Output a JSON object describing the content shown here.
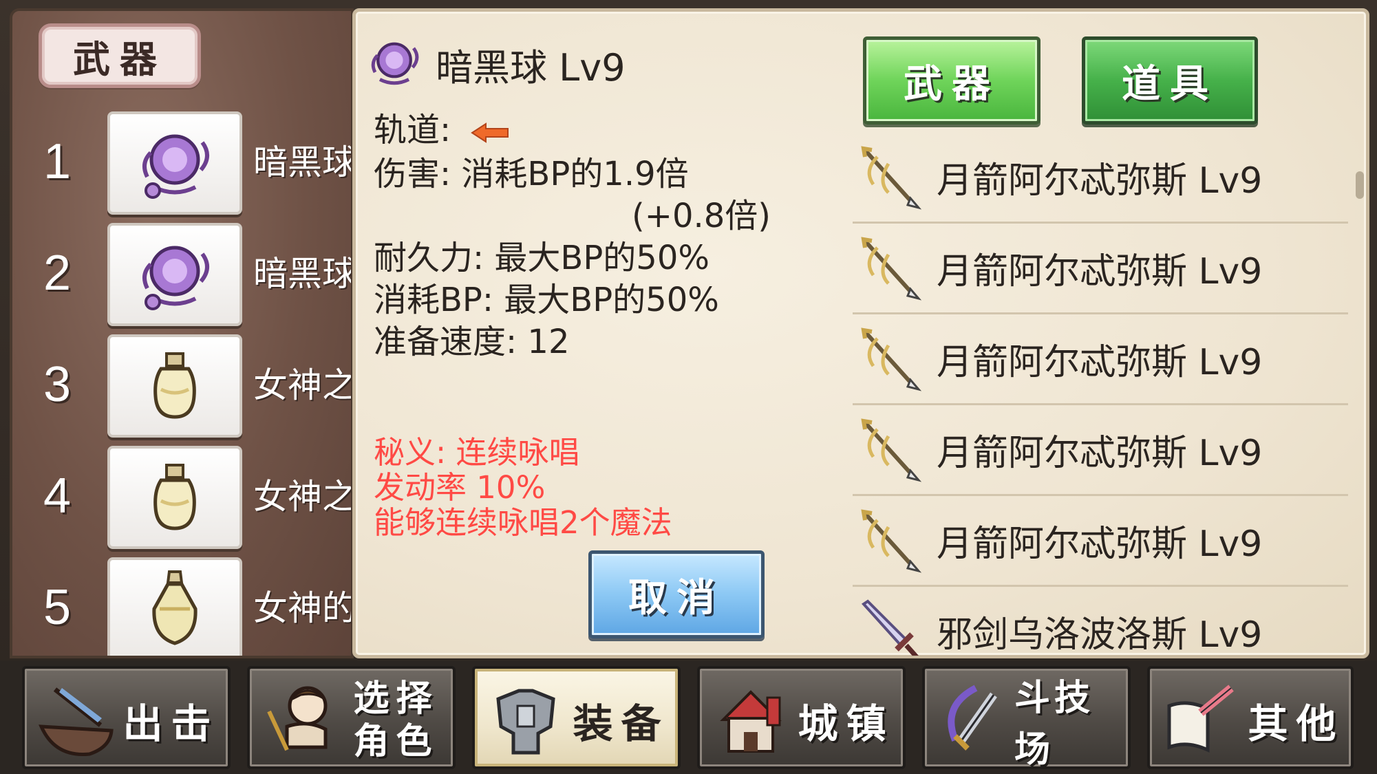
{
  "left_panel": {
    "title": "武器",
    "slots": [
      {
        "num": "1",
        "name": "暗黑球",
        "icon": "dark-orb-icon"
      },
      {
        "num": "2",
        "name": "暗黑球",
        "icon": "dark-orb-icon"
      },
      {
        "num": "3",
        "name": "女神之",
        "icon": "potion-bottle-icon"
      },
      {
        "num": "4",
        "name": "女神之",
        "icon": "potion-bottle-icon"
      },
      {
        "num": "5",
        "name": "女神的",
        "icon": "elixir-flask-icon"
      }
    ]
  },
  "detail": {
    "item_icon": "dark-orb-icon",
    "item_name": "暗黑球 Lv9",
    "track_label": "轨道:",
    "damage": "伤害: 消耗BP的1.9倍",
    "damage_bonus": "(+0.8倍)",
    "durability": "耐久力: 最大BP的50%",
    "bp_cost": "消耗BP: 最大BP的50%",
    "prep_speed": "准备速度: 12",
    "secret_name": "秘义: 连续咏唱",
    "secret_rate": "发动率 10%",
    "secret_desc": "能够连续咏唱2个魔法",
    "cancel_label": "取消",
    "accent_color": "#ff4a45"
  },
  "tabs": {
    "weapon_label": "武器",
    "item_label": "道具"
  },
  "item_list": [
    {
      "name": "月箭阿尔忒弥斯 Lv9",
      "icon": "moon-arrow-icon"
    },
    {
      "name": "月箭阿尔忒弥斯 Lv9",
      "icon": "moon-arrow-icon"
    },
    {
      "name": "月箭阿尔忒弥斯 Lv9",
      "icon": "moon-arrow-icon"
    },
    {
      "name": "月箭阿尔忒弥斯 Lv9",
      "icon": "moon-arrow-icon"
    },
    {
      "name": "月箭阿尔忒弥斯 Lv9",
      "icon": "moon-arrow-icon"
    },
    {
      "name": "邪剑乌洛波洛斯 Lv9",
      "icon": "evil-sword-icon"
    }
  ],
  "nav": [
    {
      "label": "出击",
      "icon": "sortie-ship-icon"
    },
    {
      "label_line1": "选择",
      "label_line2": "角色",
      "icon": "character-select-icon"
    },
    {
      "label": "装备",
      "icon": "armor-icon"
    },
    {
      "label": "城镇",
      "icon": "town-castle-icon"
    },
    {
      "label": "斗技场",
      "icon": "arena-sword-icon"
    },
    {
      "label": "其他",
      "icon": "scroll-quill-icon"
    }
  ]
}
